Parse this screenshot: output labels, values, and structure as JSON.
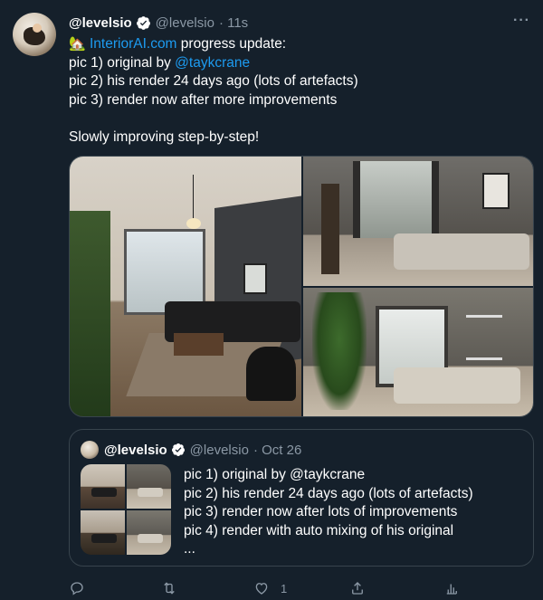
{
  "tweet": {
    "display_name": "@levelsio",
    "handle": "@levelsio",
    "time": "· 11s",
    "more_label": "···",
    "house_emoji": "🏡",
    "line1_link": "InteriorAI.com",
    "line1_rest": " progress update:",
    "line2_prefix": "pic 1) original by ",
    "line2_mention": "@taykcrane",
    "line3": "pic 2) his render 24 days ago (lots of artefacts)",
    "line4": "pic 3) render now after more improvements",
    "line5": "Slowly improving step-by-step!"
  },
  "media": {
    "images": [
      "interior-photo-original",
      "interior-render-24-days-ago",
      "interior-render-now"
    ]
  },
  "quote": {
    "display_name": "@levelsio",
    "handle": "@levelsio",
    "date": "· Oct 26",
    "lines": [
      "pic 1) original by @taykcrane",
      "pic 2) his render 24 days ago (lots of artefacts)",
      "pic 3) render now after lots of improvements",
      "pic 4) render with auto mixing of his original",
      "..."
    ]
  },
  "actions": {
    "like_count": "1"
  },
  "colors": {
    "background": "#15202b",
    "accent": "#1d9bf0",
    "muted": "#8b98a5",
    "border": "#38444d"
  },
  "icons": [
    "verified-badge-icon",
    "more-icon",
    "reply-icon",
    "retweet-icon",
    "like-icon",
    "share-icon",
    "stats-icon"
  ]
}
